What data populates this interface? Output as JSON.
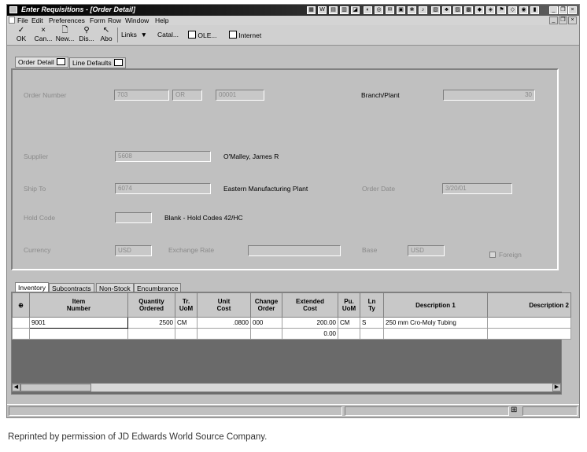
{
  "window": {
    "title": "Enter Requisitions - [Order Detail]"
  },
  "menu": {
    "items": [
      "File",
      "Edit",
      "Preferences",
      "Form",
      "Row",
      "Window",
      "Help"
    ]
  },
  "toolbar": {
    "buttons": [
      {
        "label": "OK",
        "icon": "check-icon"
      },
      {
        "label": "Can...",
        "icon": "cancel-x-icon"
      },
      {
        "label": "New...",
        "icon": "new-document-icon"
      },
      {
        "label": "Dis...",
        "icon": "display-icon"
      },
      {
        "label": "Abo",
        "icon": "about-icon"
      }
    ],
    "links_label": "Links",
    "catal_label": "Catal...",
    "ole_label": "OLE...",
    "internet_label": "Internet"
  },
  "form_tabs": [
    "Order Detail",
    "Line Defaults"
  ],
  "header": {
    "order_number_label": "Order Number",
    "order_number": "703",
    "order_type": "OR",
    "order_company": "00001",
    "branch_plant_label": "Branch/Plant",
    "branch_plant": "30",
    "supplier_label": "Supplier",
    "supplier": "5608",
    "supplier_name": "O'Malley, James R",
    "ship_to_label": "Ship To",
    "ship_to": "6074",
    "ship_to_name": "Eastern Manufacturing Plant",
    "order_date_label": "Order Date",
    "order_date": "3/20/01",
    "hold_code_label": "Hold Code",
    "hold_code": "",
    "hold_code_desc": "Blank - Hold Codes 42/HC",
    "currency_label": "Currency",
    "currency": "USD",
    "exchange_rate_label": "Exchange Rate",
    "exchange_rate": "",
    "base_label": "Base",
    "base": "USD",
    "foreign_label": "Foreign"
  },
  "detail_tabs": [
    "Inventory",
    "Subcontracts",
    "Non-Stock",
    "Encumbrance"
  ],
  "grid": {
    "columns": [
      "Item Number",
      "Quantity Ordered",
      "Tr. UoM",
      "Unit Cost",
      "Change Order",
      "Extended Cost",
      "Pu. UoM",
      "Ln Ty",
      "Description 1",
      "Description 2"
    ],
    "column_lines": [
      [
        "Item",
        "Number"
      ],
      [
        "Quantity",
        "Ordered"
      ],
      [
        "Tr.",
        "UoM"
      ],
      [
        "Unit",
        "Cost"
      ],
      [
        "Change",
        "Order"
      ],
      [
        "Extended",
        "Cost"
      ],
      [
        "Pu.",
        "UoM"
      ],
      [
        "Ln",
        "Ty"
      ],
      [
        "Description 1",
        ""
      ],
      [
        "Description 2",
        ""
      ]
    ],
    "rows": [
      [
        "9001",
        "2500",
        "CM",
        ".0800",
        "000",
        "200.00",
        "CM",
        "S",
        "250 mm Cro-Moly Tubing",
        ""
      ],
      [
        "",
        "",
        "",
        "",
        "",
        "0.00",
        "",
        "",
        "",
        ""
      ]
    ]
  },
  "caption": "Reprinted by permission of JD Edwards World Source Company."
}
